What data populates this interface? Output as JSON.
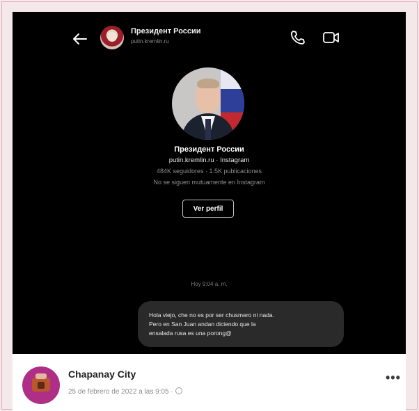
{
  "header": {
    "name": "Президент России",
    "subtitle": "putin.kremlin.ru"
  },
  "profile": {
    "name": "Президент России",
    "handle": "putin.kremlin.ru · Instagram",
    "stats": "484K seguidores · 1.5K publicaciones",
    "note": "No se siguen mutuamente en Instagram",
    "view_button": "Ver perfil"
  },
  "conversation": {
    "timestamp": "Hoy 9:04 a. m.",
    "message_lines": [
      "Hola viejo, che no es por ser chusmero ni nada.",
      "Pero en San Juan andan diciendo que la",
      "ensalada rusa es una porong@"
    ]
  },
  "post": {
    "page_name": "Chapanay City",
    "date": "25 de febrero de 2022 a las 9:05 ·",
    "more_label": "•••"
  },
  "icons": [
    "back-arrow-icon",
    "phone-icon",
    "video-camera-icon",
    "globe-icon",
    "more-options-icon"
  ],
  "colors": {
    "chat_bg": "#000000",
    "bubble_bg": "#2a2a2a",
    "page_avatar": "#b02f86",
    "frame_border": "#e2a7b3"
  }
}
